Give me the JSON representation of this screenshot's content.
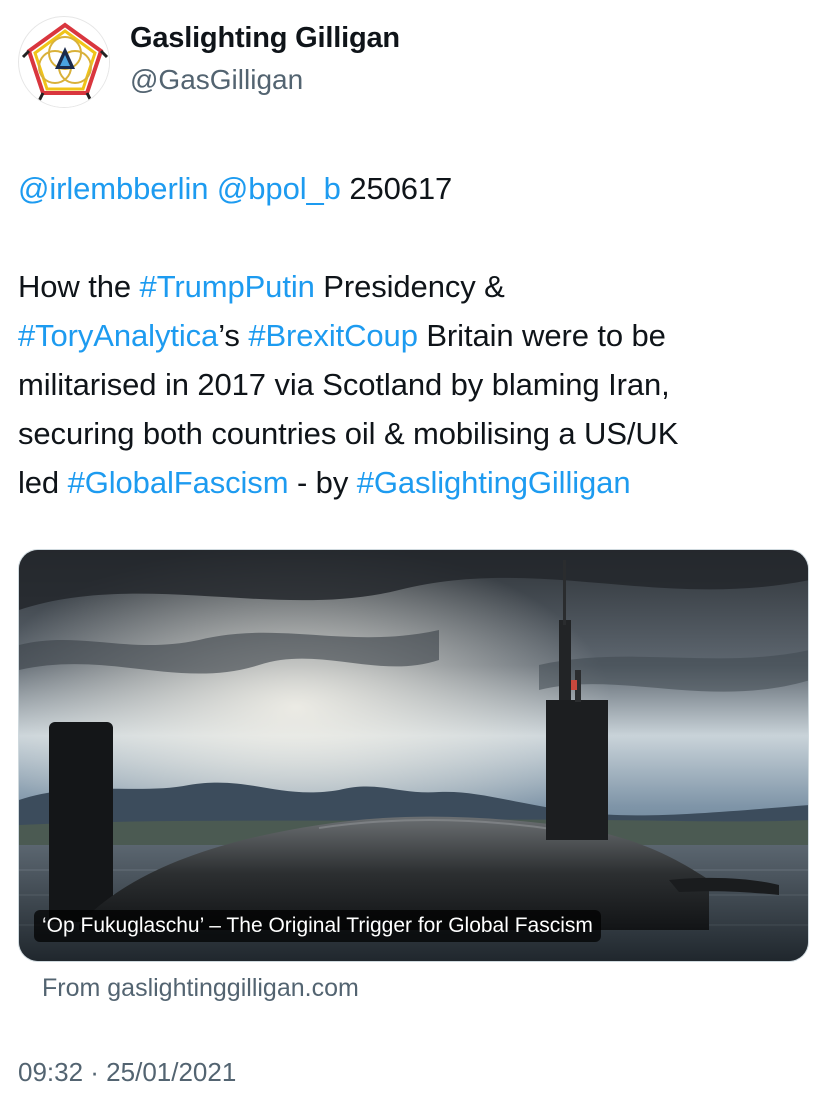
{
  "author": {
    "display_name": "Gaslighting Gilligan",
    "handle": "@GasGilligan",
    "avatar_icon": "geometric-logo-icon"
  },
  "tweet": {
    "line1": {
      "mention1": "@irlembberlin",
      "mention2": "@bpol_b",
      "date_code": "250617"
    },
    "line2": {
      "t1": "How the ",
      "hashtag1": "#TrumpPutin",
      "t2": " Presidency &"
    },
    "line3": {
      "hashtag2": "#ToryAnalytica",
      "t3": "’s ",
      "hashtag3": "#BrexitCoup",
      "t4": " Britain were to be"
    },
    "line4": "militarised in 2017 via Scotland by blaming Iran,",
    "line5": "securing both countries oil & mobilising a US/UK",
    "line6": {
      "t5": "led ",
      "hashtag4": "#GlobalFascism",
      "t6": " - by ",
      "hashtag5": "#GaslightingGilligan"
    }
  },
  "card": {
    "caption": "‘Op Fukuglaschu’ – The Original Trigger for Global Fascism",
    "source": "From gaslightinggilligan.com",
    "image_subject": "submarine-photo"
  },
  "timestamp": "09:32 · 25/01/2021",
  "colors": {
    "link": "#1d9bf0",
    "text": "#0f1419",
    "secondary": "#536471"
  }
}
